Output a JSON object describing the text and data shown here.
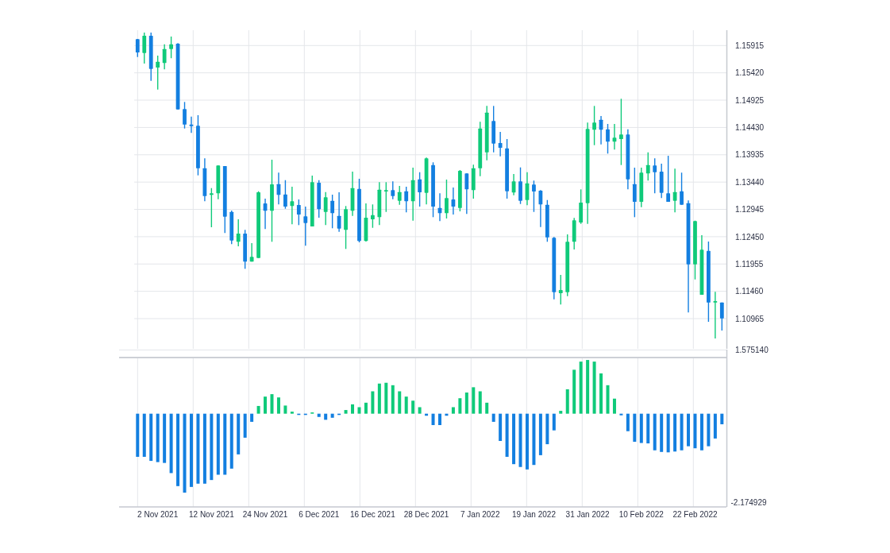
{
  "price_chart": {
    "chart_data": {
      "type": "candlestick",
      "grid": true,
      "categories": [
        null,
        null,
        null,
        null,
        null,
        null,
        null,
        null,
        null,
        null,
        null,
        null,
        null,
        null,
        null,
        null,
        null,
        null,
        null,
        null,
        null,
        null,
        null,
        null,
        null,
        null,
        null,
        null,
        null,
        null,
        null,
        null,
        null,
        null,
        null,
        null,
        null,
        null,
        null,
        null,
        null,
        null,
        null,
        null,
        null,
        null,
        null,
        null,
        null,
        null,
        null,
        null,
        null,
        null,
        null,
        null,
        null,
        null,
        null,
        null,
        null,
        null,
        null,
        null,
        null,
        null,
        null,
        null,
        null,
        null,
        null,
        null,
        null,
        null,
        null,
        null,
        null,
        null,
        null,
        null,
        null,
        null,
        null,
        null,
        null,
        null,
        null,
        null
      ],
      "ohlc": [
        [
          1.1603,
          1.16035,
          1.15708,
          1.1579
        ],
        [
          1.1578,
          1.1615,
          1.15588,
          1.16092
        ],
        [
          1.16092,
          1.1615,
          1.15276,
          1.15492
        ],
        [
          1.15516,
          1.15732,
          1.15117,
          1.15621
        ],
        [
          1.15598,
          1.15938,
          1.15483,
          1.15852
        ],
        [
          1.15852,
          1.16078,
          1.15685,
          1.15938
        ],
        [
          1.15948,
          1.15958,
          1.14757,
          1.14757
        ],
        [
          1.14763,
          1.14892,
          1.14411,
          1.14483
        ],
        [
          1.14483,
          1.14627,
          1.14331,
          1.14455
        ],
        [
          1.1446,
          1.14652,
          1.13562,
          1.13691
        ],
        [
          1.13691,
          1.1387,
          1.13092,
          1.13187
        ],
        [
          1.13207,
          1.13331,
          1.12621,
          1.13236
        ],
        [
          1.13236,
          1.1374,
          1.1313,
          1.1374
        ],
        [
          1.1373,
          1.1373,
          1.12516,
          1.12813
        ],
        [
          1.12899,
          1.12924,
          1.12314,
          1.12381
        ],
        [
          1.12358,
          1.12765,
          1.12276,
          1.12506
        ],
        [
          1.12506,
          1.12574,
          1.11868,
          1.11998
        ],
        [
          1.11998,
          1.12333,
          1.11998,
          1.12084
        ],
        [
          1.12064,
          1.13274,
          1.12064,
          1.13255
        ],
        [
          1.13053,
          1.1314,
          1.12588,
          1.12919
        ],
        [
          1.12919,
          1.13845,
          1.12358,
          1.13399
        ],
        [
          1.13403,
          1.13611,
          1.13035,
          1.13207
        ],
        [
          1.13216,
          1.13475,
          1.12957,
          1.12996
        ],
        [
          1.13006,
          1.13356,
          1.12675,
          1.13092
        ],
        [
          1.13025,
          1.13125,
          1.1266,
          1.12852
        ],
        [
          1.12819,
          1.12996,
          1.12286,
          1.12698
        ],
        [
          1.12636,
          1.13557,
          1.12636,
          1.13438
        ],
        [
          1.13428,
          1.13475,
          1.12794,
          1.12948
        ],
        [
          1.12899,
          1.13259,
          1.1266,
          1.13164
        ],
        [
          1.13101,
          1.13212,
          1.12603,
          1.12876
        ],
        [
          1.12827,
          1.13255,
          1.12539,
          1.12597
        ],
        [
          1.12574,
          1.13006,
          1.12228,
          1.12948
        ],
        [
          1.12919,
          1.13629,
          1.12827,
          1.13331
        ],
        [
          1.13317,
          1.135,
          1.12348,
          1.12372
        ],
        [
          1.12372,
          1.13053,
          1.12362,
          1.12794
        ],
        [
          1.12765,
          1.13035,
          1.12611,
          1.12842
        ],
        [
          1.12804,
          1.13438,
          1.1266,
          1.13302
        ],
        [
          1.13269,
          1.13438,
          1.12899,
          1.13294
        ],
        [
          1.13294,
          1.13452,
          1.1313,
          1.13187
        ],
        [
          1.13101,
          1.1337,
          1.13029,
          1.13259
        ],
        [
          1.13274,
          1.13356,
          1.12891,
          1.13092
        ],
        [
          1.13092,
          1.13701,
          1.12741,
          1.13475
        ],
        [
          1.1349,
          1.13619,
          1.12996,
          1.13255
        ],
        [
          1.13245,
          1.13884,
          1.13035,
          1.1387
        ],
        [
          1.13749,
          1.13798,
          1.12804,
          1.12996
        ],
        [
          1.12971,
          1.13236,
          1.12732,
          1.12876
        ],
        [
          1.12876,
          1.13485,
          1.1278,
          1.1315
        ],
        [
          1.13125,
          1.13341,
          1.12852,
          1.12996
        ],
        [
          1.12971,
          1.13658,
          1.12909,
          1.13644
        ],
        [
          1.13596,
          1.13596,
          1.12862,
          1.13308
        ],
        [
          1.13294,
          1.13755,
          1.1314,
          1.13691
        ],
        [
          1.13691,
          1.14532,
          1.13547,
          1.14411
        ],
        [
          1.13979,
          1.1482,
          1.13835,
          1.14699
        ],
        [
          1.14547,
          1.1482,
          1.13979,
          1.14138
        ],
        [
          1.14148,
          1.1435,
          1.13907,
          1.14061
        ],
        [
          1.14051,
          1.1422,
          1.1314,
          1.13274
        ],
        [
          1.13251,
          1.13586,
          1.13202,
          1.13452
        ],
        [
          1.13452,
          1.13706,
          1.13043,
          1.13101
        ],
        [
          1.13115,
          1.13619,
          1.1302,
          1.13418
        ],
        [
          1.13395,
          1.13467,
          1.12899,
          1.13269
        ],
        [
          1.13284,
          1.13294,
          1.12626,
          1.13035
        ],
        [
          1.13029,
          1.13115,
          1.12358,
          1.12438
        ],
        [
          1.1243,
          1.12444,
          1.11315,
          1.11445
        ],
        [
          1.11426,
          1.11757,
          1.1122,
          1.11483
        ],
        [
          1.11445,
          1.12492,
          1.11373,
          1.12358
        ],
        [
          1.12358,
          1.1279,
          1.12218,
          1.12747
        ],
        [
          1.12708,
          1.13308,
          1.12683,
          1.13068
        ],
        [
          1.13058,
          1.14518,
          1.12683,
          1.14403
        ],
        [
          1.14388,
          1.1482,
          1.14109,
          1.14518
        ],
        [
          1.1457,
          1.14638,
          1.14123,
          1.14388
        ],
        [
          1.14397,
          1.14494,
          1.13956,
          1.14172
        ],
        [
          1.14172,
          1.14494,
          1.14028,
          1.14244
        ],
        [
          1.1422,
          1.1495,
          1.13749,
          1.14302
        ],
        [
          1.14302,
          1.14397,
          1.13308,
          1.1349
        ],
        [
          1.13403,
          1.13701,
          1.12804,
          1.13082
        ],
        [
          1.13082,
          1.13701,
          1.12986,
          1.13611
        ],
        [
          1.13596,
          1.13979,
          1.13467,
          1.13749
        ],
        [
          1.1374,
          1.1387,
          1.13236,
          1.13619
        ],
        [
          1.13629,
          1.13773,
          1.1315,
          1.13245
        ],
        [
          1.13236,
          1.13917,
          1.13082,
          1.13082
        ],
        [
          1.13101,
          1.13683,
          1.12891,
          1.13259
        ],
        [
          1.13274,
          1.13611,
          1.13029,
          1.13029
        ],
        [
          1.13058,
          1.13107,
          1.11076,
          1.11949
        ],
        [
          1.11949,
          1.12741,
          1.11675,
          1.12732
        ],
        [
          1.11397,
          1.12477,
          1.11397,
          1.12214
        ],
        [
          1.12194,
          1.12362,
          1.10907,
          1.11257
        ],
        [
          1.11257,
          1.1145,
          1.10605,
          1.11282
        ],
        [
          1.11257,
          1.11257,
          1.10749,
          1.10969
        ]
      ],
      "ylim": [
        1.10418,
        1.16193
      ],
      "yticks": [
        {
          "value": 1.15915,
          "label": "1.15915"
        },
        {
          "value": 1.1542,
          "label": "1.15420"
        },
        {
          "value": 1.14925,
          "label": "1.14925"
        },
        {
          "value": 1.1443,
          "label": "1.14430"
        },
        {
          "value": 1.13935,
          "label": "1.13935"
        },
        {
          "value": 1.1344,
          "label": "1.13440"
        },
        {
          "value": 1.12945,
          "label": "1.12945"
        },
        {
          "value": 1.1245,
          "label": "1.12450"
        },
        {
          "value": 1.11955,
          "label": "1.11955"
        },
        {
          "value": 1.1146,
          "label": "1.11460"
        },
        {
          "value": 1.10965,
          "label": "1.10965"
        }
      ]
    }
  },
  "oscillator_chart": {
    "chart_data": {
      "type": "bar",
      "grid": true,
      "categories": [
        null,
        null,
        null,
        "2 Nov 2021",
        null,
        null,
        null,
        null,
        null,
        null,
        null,
        "12 Nov 2021",
        null,
        null,
        null,
        null,
        null,
        null,
        null,
        "24 Nov 2021",
        null,
        null,
        null,
        null,
        null,
        null,
        null,
        "6 Dec 2021",
        null,
        null,
        null,
        null,
        null,
        null,
        null,
        "16 Dec 2021",
        null,
        null,
        null,
        null,
        null,
        null,
        null,
        "28 Dec 2021",
        null,
        null,
        null,
        null,
        null,
        null,
        null,
        "7 Jan 2022",
        null,
        null,
        null,
        null,
        null,
        null,
        null,
        "19 Jan 2022",
        null,
        null,
        null,
        null,
        null,
        null,
        null,
        "31 Jan 2022",
        null,
        null,
        null,
        null,
        null,
        null,
        null,
        "10 Feb 2022",
        null,
        null,
        null,
        null,
        null,
        null,
        null,
        "22 Feb 2022",
        null,
        null,
        null,
        null
      ],
      "series": [
        {
          "color": "#0fca7a",
          "values": [
            null,
            null,
            null,
            null,
            null,
            null,
            null,
            null,
            null,
            null,
            null,
            null,
            null,
            null,
            null,
            null,
            null,
            null,
            0.19,
            0.42,
            0.48,
            0.4,
            0.2,
            0.05,
            null,
            null,
            0.03,
            null,
            null,
            null,
            null,
            0.09,
            0.23,
            0.16,
            0.27,
            0.55,
            0.74,
            0.76,
            0.7,
            0.55,
            0.42,
            0.32,
            0.16,
            null,
            null,
            null,
            null,
            0.16,
            0.38,
            0.52,
            0.65,
            0.55,
            0.27,
            null,
            null,
            null,
            null,
            null,
            null,
            null,
            null,
            null,
            null,
            0.07,
            0.6,
            1.08,
            1.28,
            1.32,
            1.28,
            0.99,
            0.7,
            0.37,
            null,
            null,
            null,
            null,
            null,
            null,
            null,
            null,
            null,
            null,
            null,
            null,
            null,
            null,
            null,
            null
          ]
        },
        {
          "color": "#137fe0",
          "values": [
            -1.06,
            -1.06,
            -1.16,
            -1.19,
            -1.21,
            -1.46,
            -1.78,
            -1.94,
            -1.8,
            -1.72,
            -1.72,
            -1.63,
            -1.5,
            -1.5,
            -1.35,
            -1.0,
            -0.59,
            -0.2,
            null,
            null,
            null,
            null,
            null,
            null,
            -0.03,
            -0.03,
            null,
            -0.08,
            -0.15,
            -0.1,
            -0.03,
            null,
            null,
            null,
            null,
            null,
            null,
            null,
            null,
            null,
            null,
            null,
            null,
            -0.05,
            -0.28,
            -0.28,
            -0.05,
            null,
            null,
            null,
            null,
            null,
            null,
            -0.2,
            -0.67,
            -1.06,
            -1.24,
            -1.31,
            -1.37,
            -1.26,
            -1.02,
            -0.75,
            -0.41,
            null,
            null,
            null,
            null,
            null,
            null,
            null,
            null,
            null,
            -0.04,
            -0.43,
            -0.69,
            -0.72,
            -0.73,
            -0.9,
            -0.94,
            -0.95,
            -0.93,
            -0.9,
            -0.8,
            -0.85,
            -0.9,
            -0.8,
            -0.61,
            -0.26
          ]
        }
      ],
      "ylim": [
        -2.291,
        1.57514
      ],
      "yticks": [
        {
          "value": 1.57514,
          "label": "1.575140"
        },
        {
          "value": -2.174929,
          "label": "-2.174929"
        }
      ]
    }
  }
}
